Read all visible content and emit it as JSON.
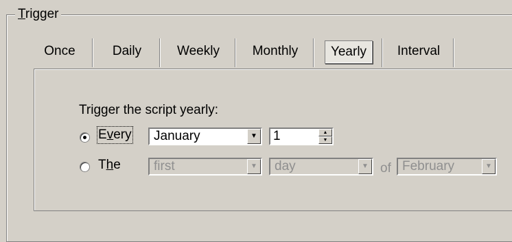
{
  "group": {
    "title_underline": "T",
    "title_rest": "rigger"
  },
  "tabs": [
    {
      "label": "Once",
      "active": false
    },
    {
      "label": "Daily",
      "active": false
    },
    {
      "label": "Weekly",
      "active": false
    },
    {
      "label": "Monthly",
      "active": false
    },
    {
      "label": "Yearly",
      "active": true
    },
    {
      "label": "Interval",
      "active": false
    }
  ],
  "panel": {
    "caption": "Trigger the script yearly:",
    "every": {
      "selected": true,
      "label_pre": "E",
      "label_ul": "v",
      "label_post": "ery",
      "month_value": "January",
      "day_value": "1"
    },
    "the": {
      "selected": false,
      "label_pre": "T",
      "label_ul": "h",
      "label_post": "e",
      "ordinal_value": "first",
      "unit_value": "day",
      "of_text": "of",
      "month_value": "February"
    }
  }
}
